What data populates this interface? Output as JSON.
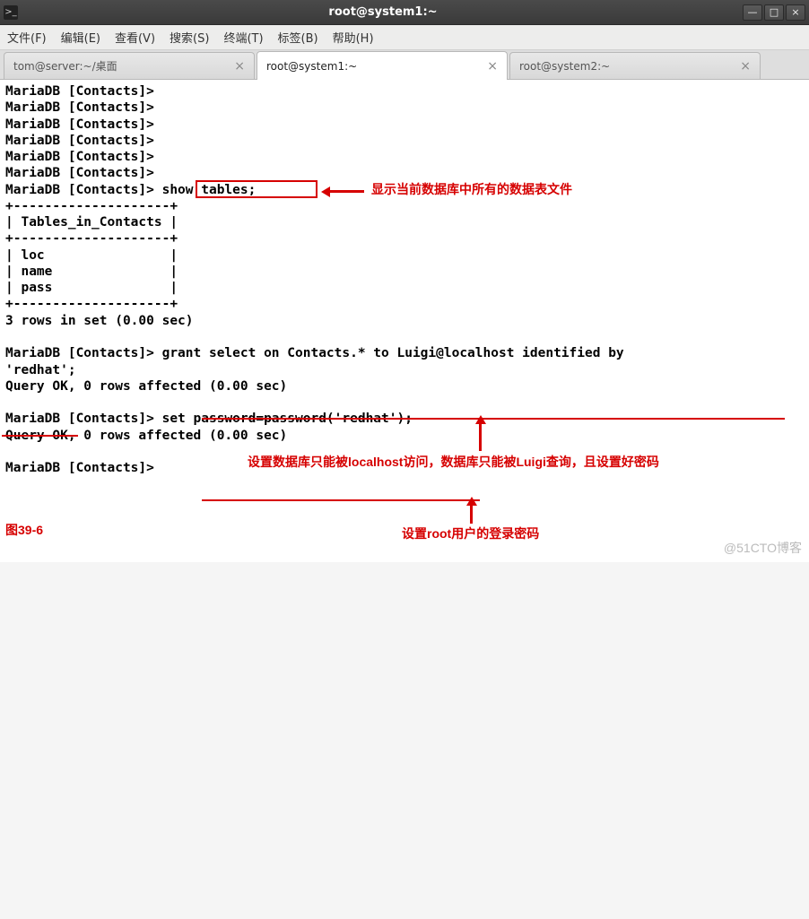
{
  "window": {
    "title": "root@system1:~"
  },
  "menus": [
    "文件(F)",
    "编辑(E)",
    "查看(V)",
    "搜索(S)",
    "终端(T)",
    "标签(B)",
    "帮助(H)"
  ],
  "tabs": [
    {
      "label": "tom@server:~/桌面",
      "active": false
    },
    {
      "label": "root@system1:~",
      "active": true
    },
    {
      "label": "root@system2:~",
      "active": false
    }
  ],
  "terminal": {
    "prompt": "MariaDB [Contacts]> ",
    "empty_prompts": 6,
    "cmd1": "show tables;",
    "table_output": "+--------------------+\n| Tables_in_Contacts |\n+--------------------+\n| loc                |\n| name               |\n| pass               |\n+--------------------+",
    "rowcount1": "3 rows in set (0.00 sec)",
    "cmd2a": "grant select on Contacts.* to Luigi@localhost identified by",
    "cmd2b": "'redhat';",
    "result2": "Query OK, 0 rows affected (0.00 sec)",
    "cmd3": "set password=password('redhat');",
    "result3": "Query OK, 0 rows affected (0.00 sec)"
  },
  "annotations": {
    "a1": "显示当前数据库中所有的数据表文件",
    "a2": "设置数据库只能被localhost访问，数据库只能被Luigi查询，且设置好密码",
    "a3": "设置root用户的登录密码",
    "figure": "图39-6"
  },
  "watermark": "@51CTO博客"
}
